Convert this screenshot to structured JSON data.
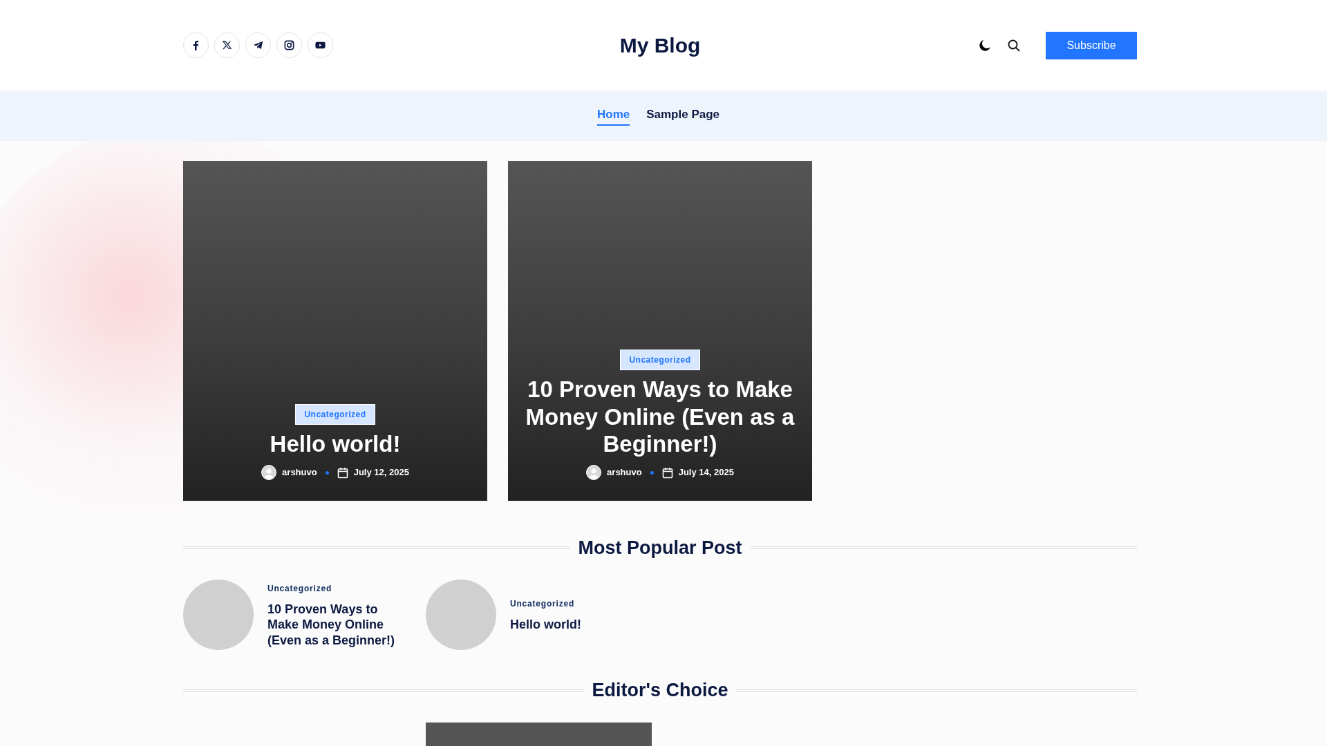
{
  "header": {
    "social": [
      {
        "kind": "facebook"
      },
      {
        "kind": "x"
      },
      {
        "kind": "telegram"
      },
      {
        "kind": "instagram"
      },
      {
        "kind": "youtube"
      }
    ],
    "site_title": "My Blog",
    "subscribe": "Subscribe"
  },
  "nav": [
    {
      "label": "Home",
      "selected": true
    },
    {
      "label": "Sample Page",
      "selected": false
    }
  ],
  "featured": [
    {
      "category": "Uncategorized",
      "title": "Hello world!",
      "author": "arshuvo",
      "date": "July 12, 2025"
    },
    {
      "category": "Uncategorized",
      "title": "10 Proven Ways to Make Money Online (Even as a Beginner!)",
      "author": "arshuvo",
      "date": "July 14, 2025"
    }
  ],
  "popular": {
    "heading": "Most Popular Post",
    "items": [
      {
        "category": "Uncategorized",
        "title": "10 Proven Ways to Make Money Online (Even as a Beginner!)"
      },
      {
        "category": "Uncategorized",
        "title": "Hello world!"
      }
    ]
  },
  "editors_choice": {
    "heading": "Editor's Choice"
  }
}
